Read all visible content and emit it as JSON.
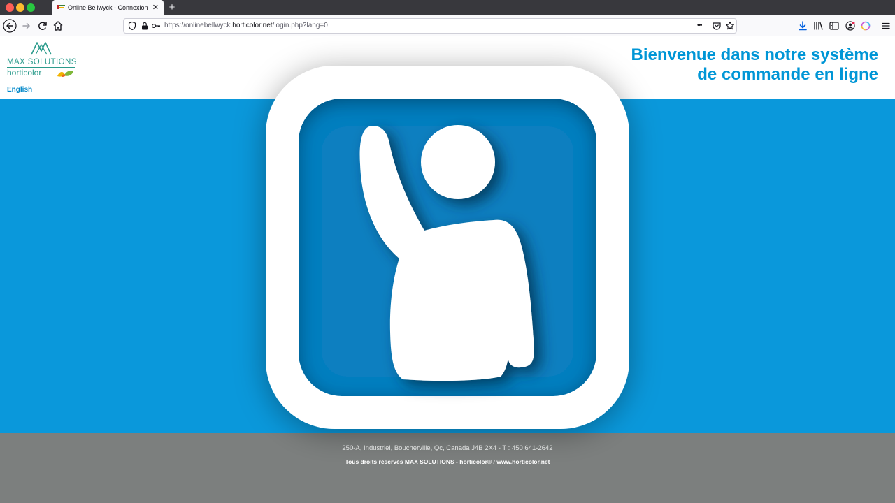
{
  "browser": {
    "tab_title": "Online Bellwyck - Connexion",
    "new_tab_symbol": "+",
    "close_symbol": "✕",
    "url_prefix": "https://onlinebellwyck.",
    "url_domain": "horticolor.net",
    "url_path": "/login.php?lang=0",
    "more_dots": "•••"
  },
  "page": {
    "logo_name": "MAX SOLUTIONS",
    "logo_sub": "horticolor",
    "language_link": "English",
    "welcome_line1": "Bienvenue dans notre système",
    "welcome_line2": "de commande en ligne"
  },
  "footer": {
    "address": "250-A, Industriel, Boucherville, Qc, Canada J4B 2X4 - T : 450 641-2642",
    "rights": "Tous droits réservés MAX SOLUTIONS - horticolor® / www.horticolor.net"
  },
  "colors": {
    "brand_blue": "#0a98db",
    "title_blue": "#0096d6",
    "logo_teal": "#2b9b8c",
    "footer_gray": "#7c7f7e"
  },
  "icons": [
    "back-arrow-icon",
    "forward-arrow-icon",
    "reload-icon",
    "home-icon",
    "shield-icon",
    "lock-icon",
    "key-icon",
    "pocket-icon",
    "star-icon",
    "download-icon",
    "library-icon",
    "sidebar-icon",
    "account-icon",
    "extension-icon",
    "menu-icon",
    "raised-hand-person-icon"
  ]
}
